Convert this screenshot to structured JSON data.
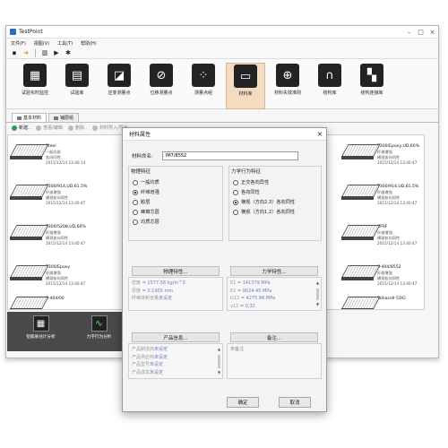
{
  "app": {
    "title": "TestPoint"
  },
  "menu": [
    "文件(F)",
    "视图(V)",
    "工具(T)",
    "帮助(H)"
  ],
  "quick_tools": [
    "save-icon",
    "exit-icon",
    "layout-icon",
    "run-icon",
    "settings-icon"
  ],
  "ribbon": [
    {
      "label": "试验实时监控",
      "icon": "monitor-icon",
      "glyph": "▦"
    },
    {
      "label": "试验库",
      "icon": "library-icon",
      "glyph": "▤"
    },
    {
      "label": "应变测量点",
      "icon": "strain-icon",
      "glyph": "◪"
    },
    {
      "label": "位移测量点",
      "icon": "displacement-icon",
      "glyph": "⊘"
    },
    {
      "label": "测量点组",
      "icon": "point-group-icon",
      "glyph": "⁘"
    },
    {
      "label": "材料库",
      "icon": "material-icon",
      "glyph": "▭",
      "active": true
    },
    {
      "label": "材料失效准则",
      "icon": "failure-criteria-icon",
      "glyph": "⊕"
    },
    {
      "label": "结构库",
      "icon": "structure-icon",
      "glyph": "∩"
    },
    {
      "label": "结构连接库",
      "icon": "connection-icon",
      "glyph": "▚"
    }
  ],
  "tabs": [
    {
      "label": "基本材料"
    },
    {
      "label": "铺层组"
    }
  ],
  "subtoolbar": [
    {
      "label": "新建..",
      "enabled": true
    },
    {
      "label": "查看/编辑",
      "enabled": false
    },
    {
      "label": "删除..",
      "enabled": false
    },
    {
      "label": "材料导入/导出",
      "enabled": false
    }
  ],
  "materials": [
    {
      "name": "Steel",
      "lines": [
        "一般均质",
        "各向同性",
        "2015/12/14 13:40:14"
      ]
    },
    {
      "name": "T300/914,UD,61.5%",
      "lines": [
        "纤维增强",
        "横观各向同性",
        "2015/12/14 13:40:47"
      ]
    },
    {
      "name": "T300/5208,UD,60%",
      "lines": [
        "纤维增强",
        "横观各向同性",
        "2015/12/14 13:40:47"
      ]
    },
    {
      "name": "T300/Epoxy",
      "lines": [
        "纤维增强",
        "横观各向同性",
        "2015/12/14 13:40:47"
      ]
    },
    {
      "name": "S-404/00",
      "lines": []
    },
    {
      "name": "T300/Epoxy,UD,60%",
      "lines": [
        "纤维增强",
        "横观各向同性",
        "2015/12/14 13:40:47"
      ]
    },
    {
      "name": "T300/914,UD,61.5%",
      "lines": [
        "纤维增强",
        "横观各向同性",
        "2015/12/14 13:40:47"
      ]
    },
    {
      "name": "CF6F",
      "lines": [
        "纤维增强",
        "横观各向同性",
        "2015/12/14 13:40:47"
      ]
    },
    {
      "name": "S-404/8552",
      "lines": [
        "纤维增强",
        "横观各向同性",
        "2015/12/14 13:40:47"
      ]
    },
    {
      "name": "Rohacell-51IG",
      "lines": []
    }
  ],
  "bottom_tools": [
    {
      "label": "铝膨胀估计分析",
      "icon": "analysis-icon"
    },
    {
      "label": "力学行为分析",
      "icon": "mechanics-icon"
    }
  ],
  "dialog": {
    "title": "材料属性",
    "name_label": "材料命名:",
    "name_value": "IM7/8552",
    "group1": {
      "title": "物理特征",
      "options": [
        "一般均质",
        "纤维增强",
        "胶层",
        "蜂窝芯层",
        "均质芯层"
      ],
      "selected": 1
    },
    "group2": {
      "title": "力学行为特征",
      "options": [
        "正交各向异性",
        "各向同性",
        "横观（方向2,3）各向同性",
        "横观（方向1,2）各向同性"
      ],
      "selected": 2
    },
    "physical_button": "物理特性...",
    "mechanical_button": "力学特性...",
    "physical_props": [
      {
        "k": "密度",
        "v": " = 1577.58 kg/m^3"
      },
      {
        "k": "厚度",
        "v": " = 0.1905 mm"
      },
      {
        "k": "纤维体积含量",
        "v": "未设定"
      }
    ],
    "mechanical_props": [
      {
        "k": "E1",
        "v": " = 141379 MPa"
      },
      {
        "k": "E2",
        "v": " = 9024.45 MPa"
      },
      {
        "k": "G12",
        "v": " = 4275.96 MPa"
      },
      {
        "k": "v12",
        "v": " = 0.32"
      }
    ],
    "product_button": "产品信息...",
    "notes_button": "备注...",
    "product_info": [
      {
        "k": "产品制造商",
        "v": "未设定"
      },
      {
        "k": "产品供应商",
        "v": "未设定"
      },
      {
        "k": "产品型号",
        "v": "未设定"
      },
      {
        "k": "产品成本",
        "v": "未设定"
      }
    ],
    "notes": "未备注",
    "ok": "确定",
    "cancel": "取消"
  }
}
